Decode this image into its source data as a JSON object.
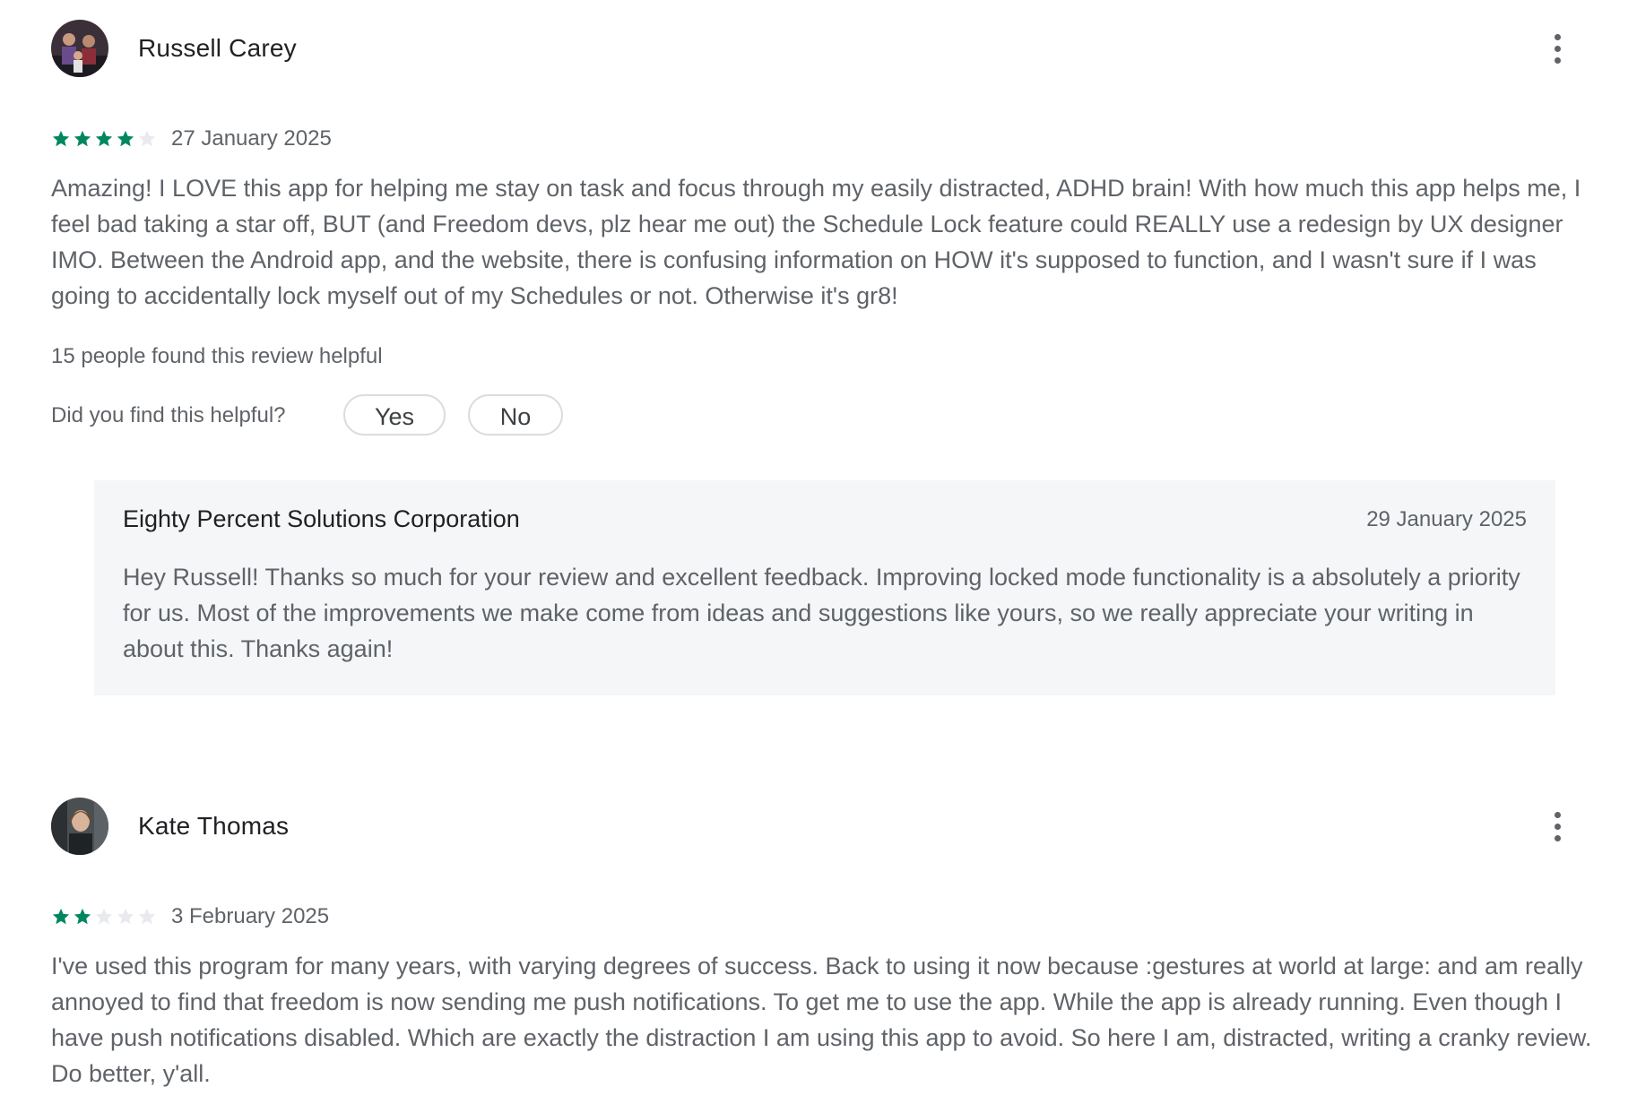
{
  "reviews": [
    {
      "author": "Russell Carey",
      "avatar_icon": "user-avatar-photo",
      "more_icon": "more-vert-icon",
      "rating": 4,
      "max_rating": 5,
      "date": "27 January 2025",
      "text": "Amazing! I LOVE this app for helping me stay on task and focus through my easily distracted, ADHD brain! With how much this app helps me, I feel bad taking a star off, BUT (and Freedom devs, plz hear me out) the Schedule Lock feature could REALLY use a redesign by UX designer IMO. Between the Android app, and the website, there is confusing information on HOW it's supposed to function, and I wasn't sure if I was going to accidentally lock myself out of my Schedules or not. Otherwise it's gr8!",
      "helpful_count_text": "15 people found this review helpful",
      "helpful_question": "Did you find this helpful?",
      "yes_label": "Yes",
      "no_label": "No",
      "reply": {
        "author": "Eighty Percent Solutions Corporation",
        "date": "29 January 2025",
        "text": "Hey Russell! Thanks so much for your review and excellent feedback. Improving locked mode functionality is a absolutely a priority for us. Most of the improvements we make come from ideas and suggestions like yours, so we really appreciate your writing in about this. Thanks again!"
      }
    },
    {
      "author": "Kate Thomas",
      "avatar_icon": "user-avatar-photo",
      "more_icon": "more-vert-icon",
      "rating": 2,
      "max_rating": 5,
      "date": "3 February 2025",
      "text": "I've used this program for many years, with varying degrees of success. Back to using it now because :gestures at world at large: and am really annoyed to find that freedom is now sending me push notifications. To get me to use the app. While the app is already running. Even though I have push notifications disabled. Which are exactly the distraction I am using this app to avoid. So here I am, distracted, writing a cranky review. Do better, y'all."
    }
  ],
  "colors": {
    "star_filled": "#01875f",
    "star_empty": "#e8eaed",
    "text_primary": "#202124",
    "text_secondary": "#5f6368",
    "reply_background": "#f5f6f8",
    "pill_border": "#dadce0"
  }
}
